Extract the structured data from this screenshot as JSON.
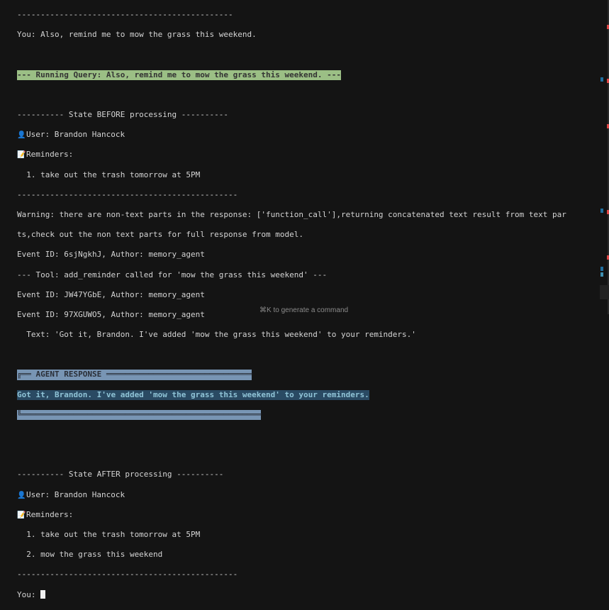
{
  "terminal": {
    "sep_long": "----------------------------------------------",
    "sep_long2": "-----------------------------------------------",
    "you_line": "You: Also, remind me to mow the grass this weekend.",
    "running_query": "--- Running Query: Also, remind me to mow the grass this weekend. ---",
    "state_before": "---------- State BEFORE processing ----------",
    "user_line": "User: Brandon Hancock",
    "reminders_label": "Reminders:",
    "before_items": [
      "  1. take out the trash tomorrow at 5PM"
    ],
    "warning_1": "Warning: there are non-text parts in the response: ['function_call'],returning concatenated text result from text par",
    "warning_2": "ts,check out the non text parts for full response from model.",
    "event_1": "Event ID: 6sjNgkhJ, Author: memory_agent",
    "tool_line": "--- Tool: add_reminder called for 'mow the grass this weekend' ---",
    "event_2": "Event ID: JW47YGbE, Author: memory_agent",
    "event_3": "Event ID: 97XGUWO5, Author: memory_agent",
    "text_line": "  Text: 'Got it, Brandon. I've added 'mow the grass this weekend' to your reminders.'",
    "agent_header": "╔══ AGENT RESPONSE ═══════════════════════════════",
    "agent_text": "Got it, Brandon. I've added 'mow the grass this weekend' to your reminders.",
    "agent_footer": "╚═══════════════════════════════════════════════════",
    "state_after": "---------- State AFTER processing ----------",
    "after_items": [
      "  1. take out the trash tomorrow at 5PM",
      "  2. mow the grass this weekend"
    ],
    "prompt": "You: "
  },
  "hint": "⌘K to generate a command",
  "icons": {
    "user": "👤",
    "memo": "📝"
  }
}
